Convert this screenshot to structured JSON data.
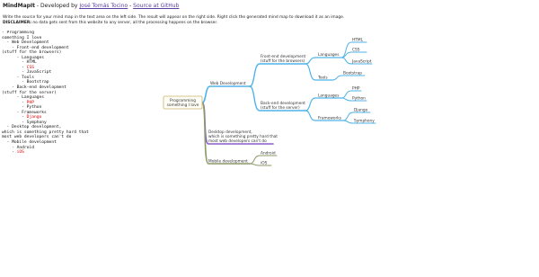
{
  "header": {
    "app_title": "MindMapIt",
    "developed_by_prefix": " - Developed by ",
    "author": "José Tomás Tocino",
    "separator": " - ",
    "source_link": "Source at GitHub",
    "description_line1": "Write the source for your mind map in the text area on the left side. The result will appear on the right side. Right click the generated mind map to download it as an image.",
    "disclaimer_label": "DISCLAIMER:",
    "disclaimer_text": " no data gets sent from this website to any server, all the processing happens on the browser."
  },
  "editor": {
    "lines": [
      "- Programming",
      "something I love",
      "  - Web Development",
      "    - Front-end development",
      "(stuff for the browsers)",
      "      - Languages",
      "        - HTML",
      "        - CSS",
      "        - JavaScript",
      "      - Tools",
      "        - Bootstrap",
      "    - Back-end development",
      "(stuff for the server)",
      "      - Languages",
      "        - PHP",
      "        - Python",
      "      - Frameworks",
      "        - Django",
      "        - Symphony",
      "  - Desktop development,",
      "which is something pretty hard that",
      "most web developers can't do",
      "  - Mobile development",
      "    - Android",
      "    - iOS"
    ]
  },
  "mindmap": {
    "root": [
      "Programming",
      "something I love"
    ],
    "web": "Web Development",
    "frontend": [
      "Front-end development",
      "(stuff for the browsers)"
    ],
    "fe_languages": "Languages",
    "html": "HTML",
    "css": "CSS",
    "javascript": "JavaScript",
    "tools": "Tools",
    "bootstrap": "Bootstrap",
    "backend": [
      "Back-end development",
      "(stuff for the server)"
    ],
    "be_languages": "Languages",
    "php": "PHP",
    "python": "Python",
    "frameworks": "Frameworks",
    "django": "Django",
    "symphony": "Symphony",
    "desktop": [
      "Desktop development,",
      "which is something pretty hard that",
      "most web developers can't do"
    ],
    "mobile": "Mobile development",
    "android": "Android",
    "ios": "iOS"
  },
  "colors": {
    "web_branch": "#4fb3e8",
    "desktop_branch": "#8b5cc8",
    "mobile_branch": "#8a9a6a",
    "root_border": "#c8b46a",
    "root_fill": "#fffff8"
  }
}
